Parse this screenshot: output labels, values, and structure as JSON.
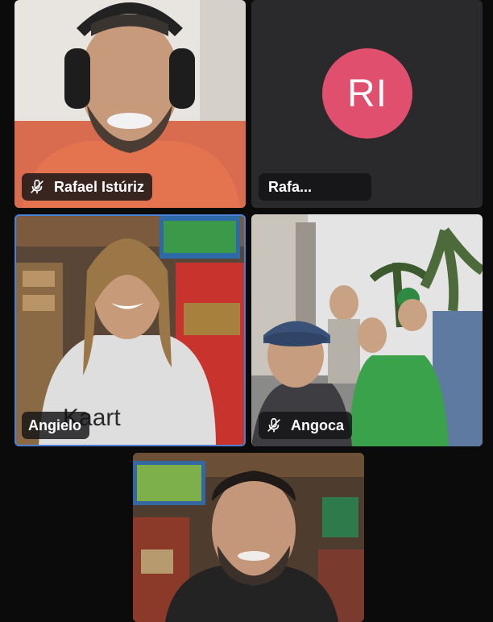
{
  "participants": [
    {
      "name": "Rafael Istúriz",
      "muted": true,
      "video": true
    },
    {
      "name": "Rafa...",
      "initials": "RI",
      "muted": false,
      "video": false,
      "avatar_color": "#e0506e"
    },
    {
      "name": "Angielo",
      "muted": false,
      "video": true,
      "active_speaker": true
    },
    {
      "name": "Angoca",
      "muted": true,
      "video": true
    },
    {
      "name": "",
      "muted": false,
      "video": true
    }
  ],
  "colors": {
    "background": "#0b0b0c",
    "tile_background": "#2a2a2c",
    "active_speaker_border": "#4a7fd4",
    "nametag_background": "#141416"
  },
  "icons": [
    "mic-off-icon"
  ],
  "shirt_text": "Kaart"
}
